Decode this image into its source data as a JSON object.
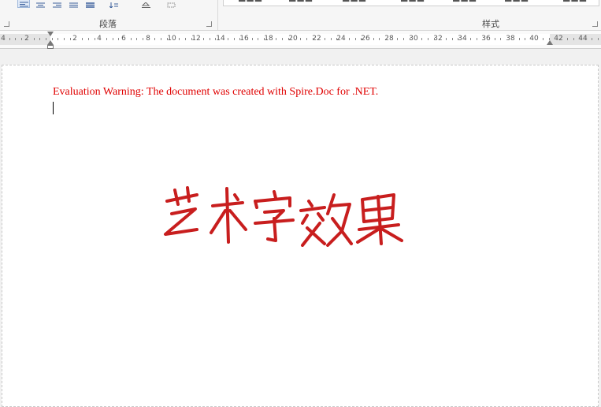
{
  "ribbon": {
    "paragraph_group_label": "段落",
    "styles_group_label": "样式"
  },
  "ruler": {
    "numbers": [
      "4",
      "2",
      "2",
      "4",
      "6",
      "8",
      "10",
      "12",
      "14",
      "16",
      "18",
      "20",
      "22",
      "24",
      "26",
      "28",
      "30",
      "32",
      "34",
      "36",
      "38",
      "40",
      "42",
      "44"
    ]
  },
  "document": {
    "warning_text": "Evaluation Warning: The document was created with Spire.Doc for .NET.",
    "wordart_text": "艺术字效果",
    "warning_color": "#e00000",
    "wordart_color": "#c81e1e"
  }
}
